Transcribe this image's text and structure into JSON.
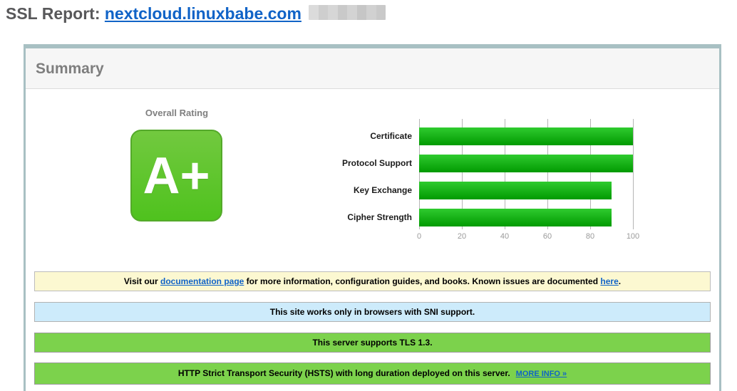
{
  "header": {
    "title_prefix": "SSL Report: ",
    "hostname": "nextcloud.linuxbabe.com"
  },
  "summary": {
    "panel_title": "Summary",
    "overall_rating_label": "Overall Rating",
    "grade": "A+"
  },
  "chart_data": {
    "type": "bar",
    "orientation": "horizontal",
    "categories": [
      "Certificate",
      "Protocol Support",
      "Key Exchange",
      "Cipher Strength"
    ],
    "values": [
      100,
      100,
      90,
      90
    ],
    "xlim": [
      0,
      100
    ],
    "xticks": [
      0,
      20,
      40,
      60,
      80,
      100
    ],
    "grid": true,
    "legend": false,
    "bar_color_top": "#2fcb2f",
    "bar_color_bottom": "#019a01"
  },
  "banners": {
    "documentation": {
      "pre": "Visit our ",
      "link1": "documentation page",
      "mid": " for more information, configuration guides, and books. Known issues are documented ",
      "link2": "here",
      "post": "."
    },
    "sni": {
      "text": "This site works only in browsers with SNI support."
    },
    "tls": {
      "text": "This server supports TLS 1.3."
    },
    "hsts": {
      "text": "HTTP Strict Transport Security (HSTS) with long duration deployed on this server.",
      "link": "MORE INFO »"
    }
  },
  "colors": {
    "grade_green_top": "#72c93f",
    "grade_green_bottom": "#4fc21e",
    "grade_border": "#54a92a",
    "banner_yellow": "#fcf8d1",
    "banner_blue": "#cdebfb",
    "banner_green": "#7cd24c",
    "link_blue": "#1063c7",
    "panel_border": "#a8c0c3",
    "title_gray": "#58585a"
  }
}
